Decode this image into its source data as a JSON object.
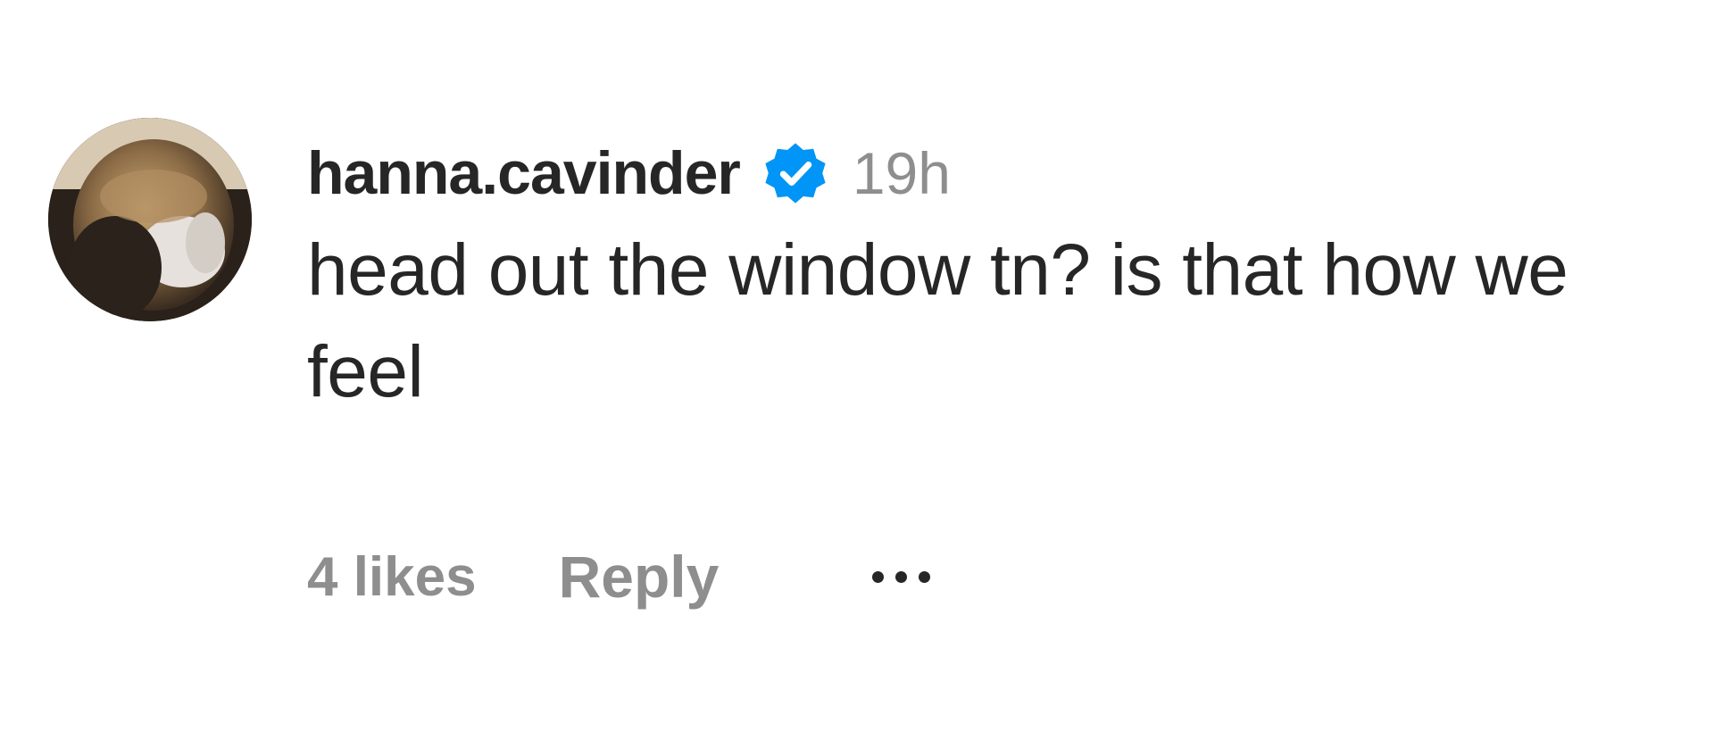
{
  "comment": {
    "username": "hanna.cavinder",
    "verified": true,
    "time": "19h",
    "text": "head out the window tn? is that how we feel",
    "likes": "4 likes",
    "reply_label": "Reply",
    "more_icon": "more-horizontal-icon",
    "avatar_icon": "profile-photo",
    "verified_icon": "verified-badge-icon"
  },
  "colors": {
    "text_primary": "#262626",
    "text_secondary": "#8e8e8e",
    "verified_blue": "#0095f6",
    "background": "#ffffff"
  }
}
